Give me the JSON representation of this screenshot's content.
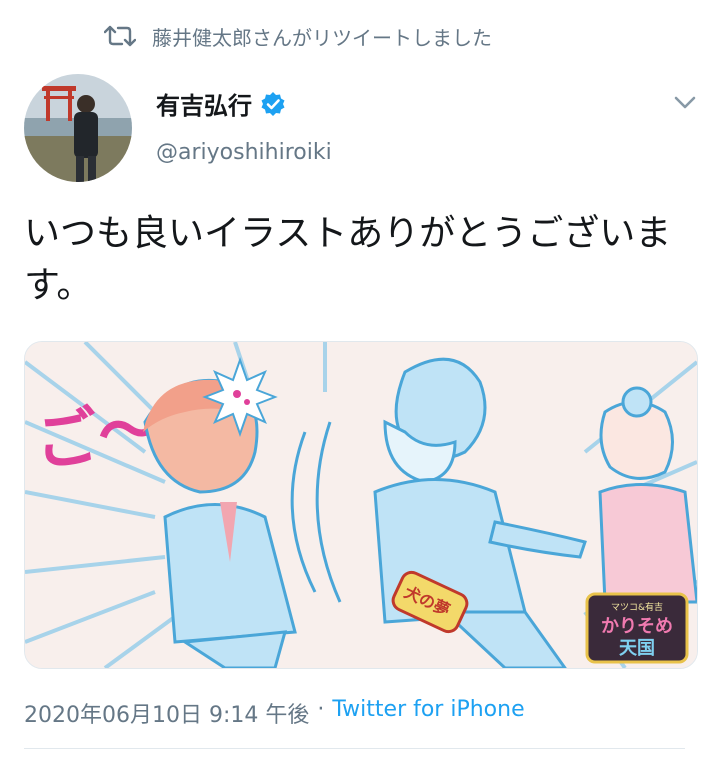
{
  "retweet": {
    "text": "藤井健太郎さんがリツイートしました"
  },
  "author": {
    "display_name": "有吉弘行",
    "handle": "@ariyoshihiroiki",
    "verified": true
  },
  "tweet": {
    "text": "いつも良いイラストありがとうございます。"
  },
  "media": {
    "sfx_text": "ご〜ん",
    "bottle_label": "犬の夢",
    "logo_top": "マツコ&有吉",
    "logo_main": "かりそめ",
    "logo_bottom": "天国"
  },
  "meta": {
    "timestamp": "2020年06月10日 9:14 午後",
    "separator": "·",
    "source": "Twitter for iPhone"
  },
  "colors": {
    "accent": "#1da1f2",
    "secondary_text": "#657786",
    "primary_text": "#14171a"
  }
}
